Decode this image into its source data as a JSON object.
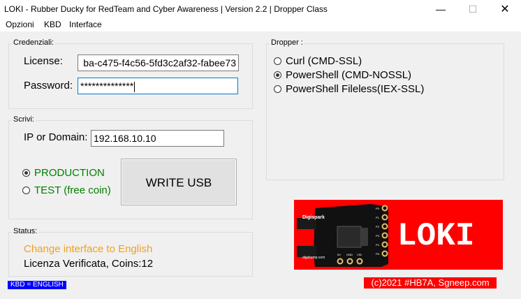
{
  "window": {
    "title": "LOKI - Rubber Ducky for RedTeam and Cyber Awareness | Version 2.2 | Dropper Class",
    "minimize_symbol": "—",
    "maximize_symbol": "☐",
    "close_symbol": "✕"
  },
  "menu": {
    "items": [
      {
        "label": "Opzioni"
      },
      {
        "label": "KBD"
      },
      {
        "label": "Interface"
      }
    ]
  },
  "credenziali": {
    "legend": "Credenziali:",
    "license_label": "License:",
    "license_value": "ba-c475-f4c56-5fd3c2af32-fabee73",
    "password_label": "Password:",
    "password_value": "**************"
  },
  "scrivi": {
    "legend": "Scrivi:",
    "ip_label": "IP or Domain:",
    "ip_value": "192.168.10.10",
    "options": [
      {
        "label": "PRODUCTION",
        "selected": true
      },
      {
        "label": "TEST (free coin)",
        "selected": false
      }
    ],
    "options_color": "#008000",
    "write_button": "WRITE USB"
  },
  "dropper": {
    "legend": "Dropper :",
    "options": [
      {
        "label": "Curl (CMD-SSL)",
        "selected": false
      },
      {
        "label": "PowerShell (CMD-NOSSL)",
        "selected": true
      },
      {
        "label": "PowerShell Fileless(IEX-SSL)",
        "selected": false
      }
    ]
  },
  "status": {
    "legend": "Status:",
    "line1": "Change interface to English",
    "line2": "Licenza Verificata, Coins:12"
  },
  "footer": {
    "kbd_badge": "KBD = ENGLISH",
    "copyright": "(c)2021 #HB7A, Sgneep.com"
  },
  "logo": {
    "text": "LOKI",
    "board_label": "Digispark",
    "board_url": "digistump.com",
    "pin_labels": [
      "P0",
      "P1",
      "P2",
      "P3",
      "P4",
      "P5",
      "5V",
      "GND",
      "VIN"
    ],
    "accent_color": "#ff0000"
  }
}
